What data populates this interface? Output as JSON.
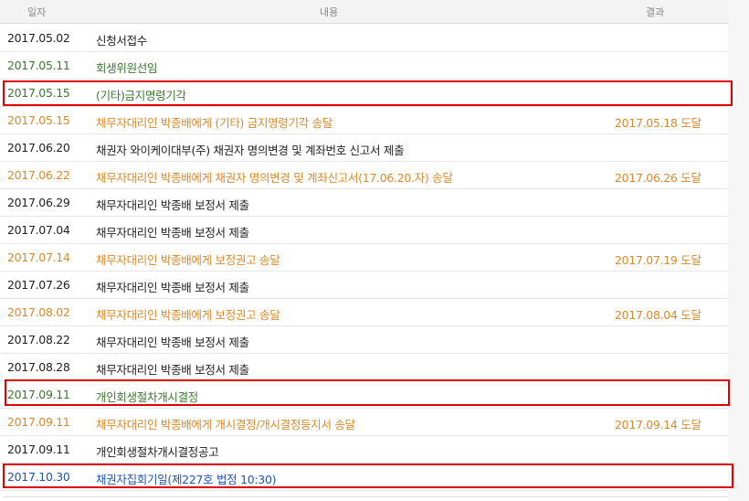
{
  "header": {
    "date": "일자",
    "content": "내용",
    "result": "결과"
  },
  "rows": [
    {
      "date": "2017.05.02",
      "content": "신청서접수",
      "result": "",
      "color": "#222222"
    },
    {
      "date": "2017.05.11",
      "content": "회생위원선임",
      "result": "",
      "color": "#3a7a2e"
    },
    {
      "date": "2017.05.15",
      "content": "(기타)금지명령기각",
      "result": "",
      "color": "#3a7a2e"
    },
    {
      "date": "2017.05.15",
      "content": "채무자대리인 박종배에게 (기타) 금지명령기각 송달",
      "result": "2017.05.18 도달",
      "color": "#d98a2b"
    },
    {
      "date": "2017.06.20",
      "content": "채권자 와이케이대부(주) 채권자 명의변경 및 계좌번호 신고서 제출",
      "result": "",
      "color": "#222222"
    },
    {
      "date": "2017.06.22",
      "content": "채무자대리인 박종배에게 채권자 명의변경 및 계좌신고서(17.06.20.자) 송달",
      "result": "2017.06.26 도달",
      "color": "#d98a2b"
    },
    {
      "date": "2017.06.29",
      "content": "채무자대리인 박종배 보정서 제출",
      "result": "",
      "color": "#222222"
    },
    {
      "date": "2017.07.04",
      "content": "채무자대리인 박종배 보정서 제출",
      "result": "",
      "color": "#222222"
    },
    {
      "date": "2017.07.14",
      "content": "채무자대리인 박종배에게 보정권고 송달",
      "result": "2017.07.19 도달",
      "color": "#d98a2b"
    },
    {
      "date": "2017.07.26",
      "content": "채무자대리인 박종배 보정서 제출",
      "result": "",
      "color": "#222222"
    },
    {
      "date": "2017.08.02",
      "content": "채무자대리인 박종배에게 보정권고 송달",
      "result": "2017.08.04 도달",
      "color": "#d98a2b"
    },
    {
      "date": "2017.08.22",
      "content": "채무자대리인 박종배 보정서 제출",
      "result": "",
      "color": "#222222"
    },
    {
      "date": "2017.08.28",
      "content": "채무자대리인 박종배 보정서 제출",
      "result": "",
      "color": "#222222"
    },
    {
      "date": "2017.09.11",
      "content": "개인회생절차개시결정",
      "result": "",
      "color": "#3a7a2e"
    },
    {
      "date": "2017.09.11",
      "content": "채무자대리인 박종배에게 개시결정/개시결정등지서 송달",
      "result": "2017.09.14 도달",
      "color": "#d98a2b"
    },
    {
      "date": "2017.09.11",
      "content": "개인회생절차개시결정공고",
      "result": "",
      "color": "#222222"
    },
    {
      "date": "2017.10.30",
      "content": "채권자집회기일(제227호 법정 10:30)",
      "result": "",
      "color": "#1f55b5"
    }
  ],
  "highlight_color": "#e00000"
}
